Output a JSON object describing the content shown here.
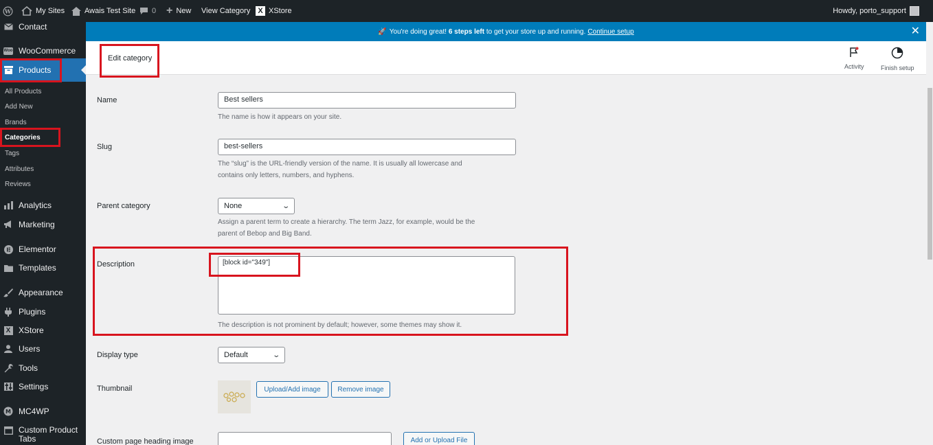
{
  "adminbar": {
    "wp_logo": "wordpress-icon",
    "my_sites": "My Sites",
    "site_name": "Awais Test Site",
    "comments_count": "0",
    "new_label": "New",
    "view_category": "View Category",
    "xstore": "XStore",
    "howdy": "Howdy, porto_support"
  },
  "sidebar": {
    "contact": "Contact",
    "woocommerce": "WooCommerce",
    "products": "Products",
    "submenu": {
      "all_products": "All Products",
      "add_new": "Add New",
      "brands": "Brands",
      "categories": "Categories",
      "tags": "Tags",
      "attributes": "Attributes",
      "reviews": "Reviews"
    },
    "analytics": "Analytics",
    "marketing": "Marketing",
    "elementor": "Elementor",
    "templates": "Templates",
    "appearance": "Appearance",
    "plugins": "Plugins",
    "xstore": "XStore",
    "users": "Users",
    "tools": "Tools",
    "settings": "Settings",
    "mc4wp": "MC4WP",
    "custom_product_tabs": "Custom Product Tabs"
  },
  "notice": {
    "emoji": "🚀",
    "text_before": "You're doing great!",
    "text_bold": "6 steps left",
    "text_after": "to get your store up and running.",
    "link": "Continue setup"
  },
  "header": {
    "title": "Edit category",
    "activity": "Activity",
    "finish_setup": "Finish setup"
  },
  "form": {
    "name_label": "Name",
    "name_value": "Best sellers",
    "name_desc": "The name is how it appears on your site.",
    "slug_label": "Slug",
    "slug_value": "best-sellers",
    "slug_desc_1": "The “slug” is the URL-friendly version of the name. It is usually all lowercase and",
    "slug_desc_2": "contains only letters, numbers, and hyphens.",
    "parent_label": "Parent category",
    "parent_value": "None",
    "parent_desc_1": "Assign a parent term to create a hierarchy. The term Jazz, for example, would be the",
    "parent_desc_2": "parent of Bebop and Big Band.",
    "description_label": "Description",
    "description_value": "[block id=\"349\"]",
    "description_desc": "The description is not prominent by default; however, some themes may show it.",
    "display_type_label": "Display type",
    "display_type_value": "Default",
    "thumbnail_label": "Thumbnail",
    "upload_image": "Upload/Add image",
    "remove_image": "Remove image",
    "custom_heading_label": "Custom page heading image",
    "add_upload_file": "Add or Upload File"
  },
  "colors": {
    "accent": "#2271b1",
    "annotation": "#d8141e",
    "notice_bg": "#007cba",
    "sidebar_bg": "#1d2327"
  }
}
